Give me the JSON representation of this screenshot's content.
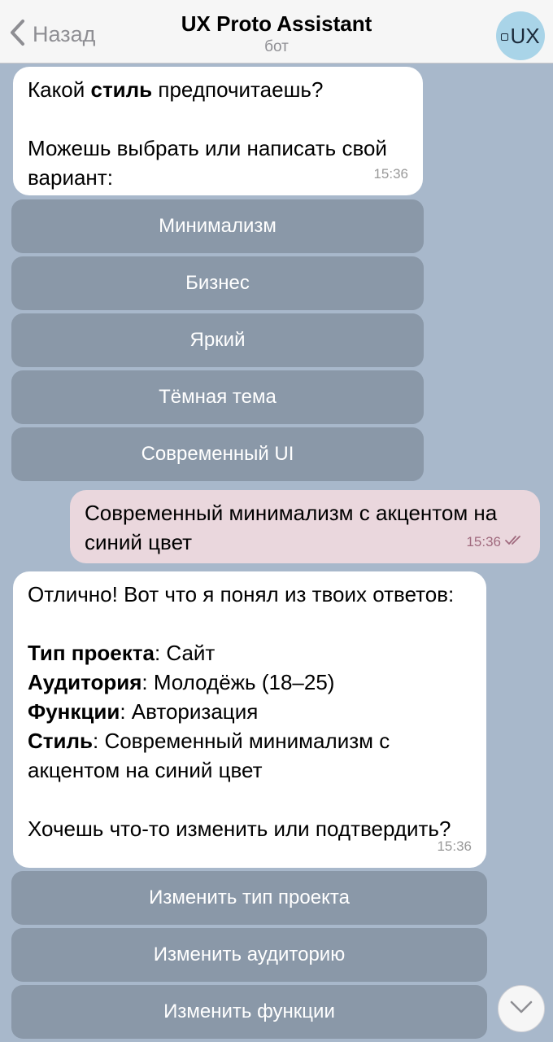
{
  "header": {
    "back_label": "Назад",
    "title": "UX Proto Assistant",
    "subtitle": "бот",
    "avatar_text": "UX",
    "avatar_color": "#a9d4e8"
  },
  "messages": {
    "m1": {
      "line1_pre": "Какой ",
      "line1_bold": "стиль",
      "line1_post": " предпочитаешь?",
      "line2": "Можешь выбрать или написать свой вариант:",
      "time": "15:36"
    },
    "style_buttons": [
      "Минимализм",
      "Бизнес",
      "Яркий",
      "Тёмная тема",
      "Современный UI"
    ],
    "m2": {
      "text": "Современный минимализм с акцентом на синий цвет",
      "time": "15:36"
    },
    "m3": {
      "intro": "Отлично! Вот что я понял из твоих ответов:",
      "rows": [
        {
          "key": "Тип проекта",
          "value": ": Сайт"
        },
        {
          "key": "Аудитория",
          "value": ": Молодёжь (18–25)"
        },
        {
          "key": "Функции",
          "value": ": Авторизация"
        },
        {
          "key": "Стиль",
          "value": ": Современный минимализм с акцентом на синий цвет"
        }
      ],
      "outro": "Хочешь что-то изменить или подтвердить?",
      "time": "15:36"
    },
    "edit_buttons": [
      "Изменить тип проекта",
      "Изменить аудиторию",
      "Изменить функции"
    ]
  },
  "icons": {
    "back": "chevron-left-icon",
    "read": "double-check-icon",
    "scroll": "chevron-down-icon"
  },
  "colors": {
    "chat_background": "#a8b8cb",
    "incoming_bubble": "#ffffff",
    "outgoing_bubble": "#ead7dd",
    "keyboard_button": "#8a98a8"
  }
}
